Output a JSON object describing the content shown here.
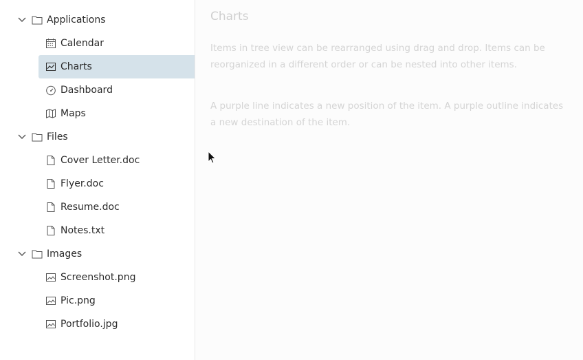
{
  "tree": {
    "groups": [
      {
        "label": "Applications",
        "items": [
          "Calendar",
          "Charts",
          "Dashboard",
          "Maps"
        ]
      },
      {
        "label": "Files",
        "items": [
          "Cover Letter.doc",
          "Flyer.doc",
          "Resume.doc",
          "Notes.txt"
        ]
      },
      {
        "label": "Images",
        "items": [
          "Screenshot.png",
          "Pic.png",
          "Portfolio.jpg"
        ]
      }
    ],
    "selected": "Charts"
  },
  "content": {
    "title": "Charts",
    "paragraph1": "Items in tree view can be rearranged using drag and drop. Items can be reorganized in a different order or can be nested into other items.",
    "paragraph2": "A purple line indicates a new position of the item. A purple outline indicates a new destination of the item."
  },
  "colors": {
    "selected_bg": "#d5e2ea",
    "text": "#2b2b2b",
    "muted_text": "#d4d4d4"
  }
}
